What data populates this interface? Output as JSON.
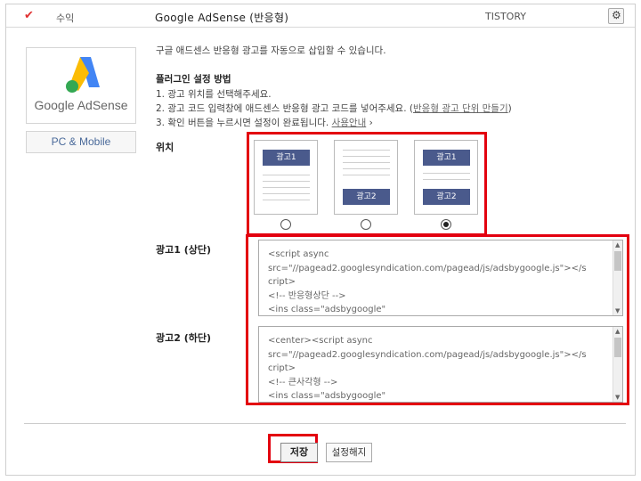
{
  "header": {
    "category": "수익",
    "title": "Google AdSense (반응형)",
    "provider": "TISTORY"
  },
  "logo": {
    "text": "Google AdSense",
    "platform": "PC & Mobile"
  },
  "description": "구글 애드센스 반응형 광고를 자동으로 삽입할 수 있습니다.",
  "howto": {
    "title": "플러그인 설정 방법",
    "step1": "1. 광고 위치를 선택해주세요.",
    "step2_prefix": "2. 광고 코드 입력창에 애드센스 반응형 광고 코드를 넣어주세요. (",
    "step2_link": "반응형 광고 단위 만들기",
    "step2_suffix": ")",
    "step3_prefix": "3. 확인 버튼을 누르시면 설정이 완료됩니다. ",
    "step3_link": "사용안내",
    "step3_suffix": " ›"
  },
  "position": {
    "label": "위치",
    "options": [
      {
        "blocks": [
          "광고1"
        ],
        "selected": false
      },
      {
        "blocks": [
          "광고2"
        ],
        "selected": false
      },
      {
        "blocks": [
          "광고1",
          "광고2"
        ],
        "selected": true
      }
    ]
  },
  "ad1": {
    "label": "광고1 (상단)",
    "code": "<script async\nsrc=\"//pagead2.googlesyndication.com/pagead/js/adsbygoogle.js\"></s\ncript>\n<!-- 반응형상단 -->\n<ins class=\"adsbygoogle\""
  },
  "ad2": {
    "label": "광고2 (하단)",
    "code": "<center><script async\nsrc=\"//pagead2.googlesyndication.com/pagead/js/adsbygoogle.js\"></s\ncript>\n<!-- 큰사각형 -->\n<ins class=\"adsbygoogle\""
  },
  "buttons": {
    "save": "저장",
    "unset": "설정해지"
  },
  "colors": {
    "highlight": "#e3000f",
    "ad_block": "#4a5a8c",
    "check": "#e03030"
  }
}
